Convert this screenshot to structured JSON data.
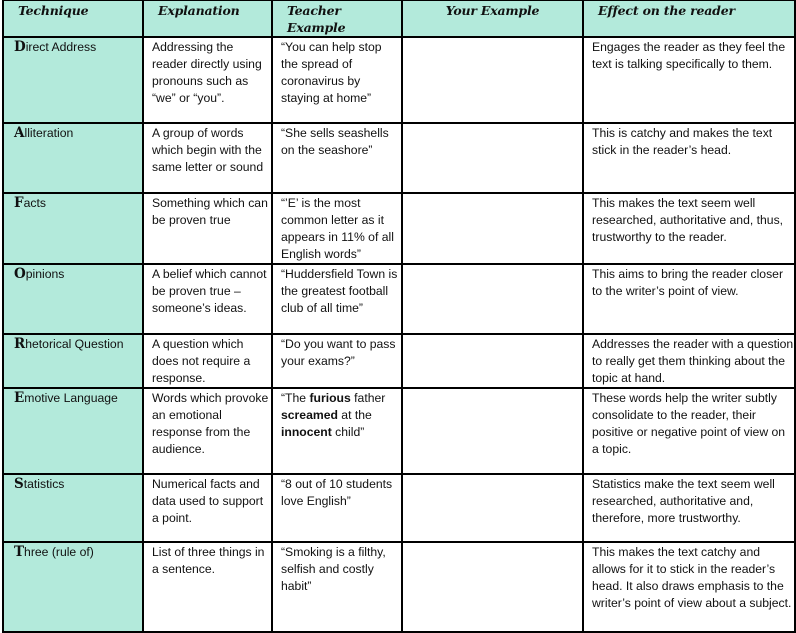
{
  "headers": {
    "technique": "Technique",
    "explanation": "Explanation",
    "teacher_example": "Teacher Example",
    "your_example": "Your Example",
    "effect": "Effect on the reader"
  },
  "colors": {
    "accent_fill": "#b3eadb",
    "border": "#000000"
  },
  "rows": [
    {
      "cap": "D",
      "rest": "irect Address",
      "explanation": "Addressing the reader directly using pronouns such as “we” or “you”.",
      "teacher_example": "“You can help stop the spread of coronavirus by staying at home”",
      "your_example": "",
      "effect": "Engages the reader as they feel the text is talking specifically to them."
    },
    {
      "cap": "A",
      "rest": "lliteration",
      "explanation": "A group of words which begin with the same letter or sound",
      "teacher_example": "“She sells seashells on the seashore”",
      "your_example": "",
      "effect": "This is catchy and makes the text stick in the reader’s head."
    },
    {
      "cap": "F",
      "rest": "acts",
      "explanation": "Something which can be proven true",
      "teacher_example": "“’E’ is the most common letter as it appears in 11% of all English words”",
      "your_example": "",
      "effect": "This makes the text seem well researched, authoritative and, thus, trustworthy to the reader."
    },
    {
      "cap": "O",
      "rest": "pinions",
      "explanation": "A belief which cannot be proven true – someone’s ideas.",
      "teacher_example": "“Huddersfield Town is the greatest football club of all time”",
      "your_example": "",
      "effect": "This aims to bring the reader closer to the writer’s point of view."
    },
    {
      "cap": "R",
      "rest": "hetorical Question",
      "explanation": "A question which does not require a response.",
      "teacher_example": "“Do you want to pass your exams?”",
      "your_example": "",
      "effect": "Addresses the reader with a question to really get them thinking about the topic at hand."
    },
    {
      "cap": "E",
      "rest": "motive Language",
      "explanation": "Words which provoke an emotional response from the audience.",
      "teacher_example_parts": [
        {
          "text": "“The ",
          "bold": false
        },
        {
          "text": "furious",
          "bold": true
        },
        {
          "text": " father ",
          "bold": false
        },
        {
          "text": "screamed",
          "bold": true
        },
        {
          "text": " at the ",
          "bold": false
        },
        {
          "text": "innocent",
          "bold": true
        },
        {
          "text": " child”",
          "bold": false
        }
      ],
      "your_example": "",
      "effect": "These words help the writer subtly consolidate to the reader, their positive or negative point of view on a topic."
    },
    {
      "cap": "S",
      "rest": "tatistics",
      "explanation": "Numerical facts and data used to support a point.",
      "teacher_example": "“8 out of 10 students love English”",
      "your_example": "",
      "effect": "Statistics make the text seem well researched, authoritative and, therefore, more trustworthy."
    },
    {
      "cap": "T",
      "rest": "hree (rule of)",
      "explanation": "List of three things in a sentence.",
      "teacher_example": "“Smoking is a filthy, selfish and costly habit”",
      "your_example": "",
      "effect": "This makes the text catchy and allows for it to stick in the reader’s head. It also draws emphasis to the writer’s point of view about a subject."
    }
  ]
}
